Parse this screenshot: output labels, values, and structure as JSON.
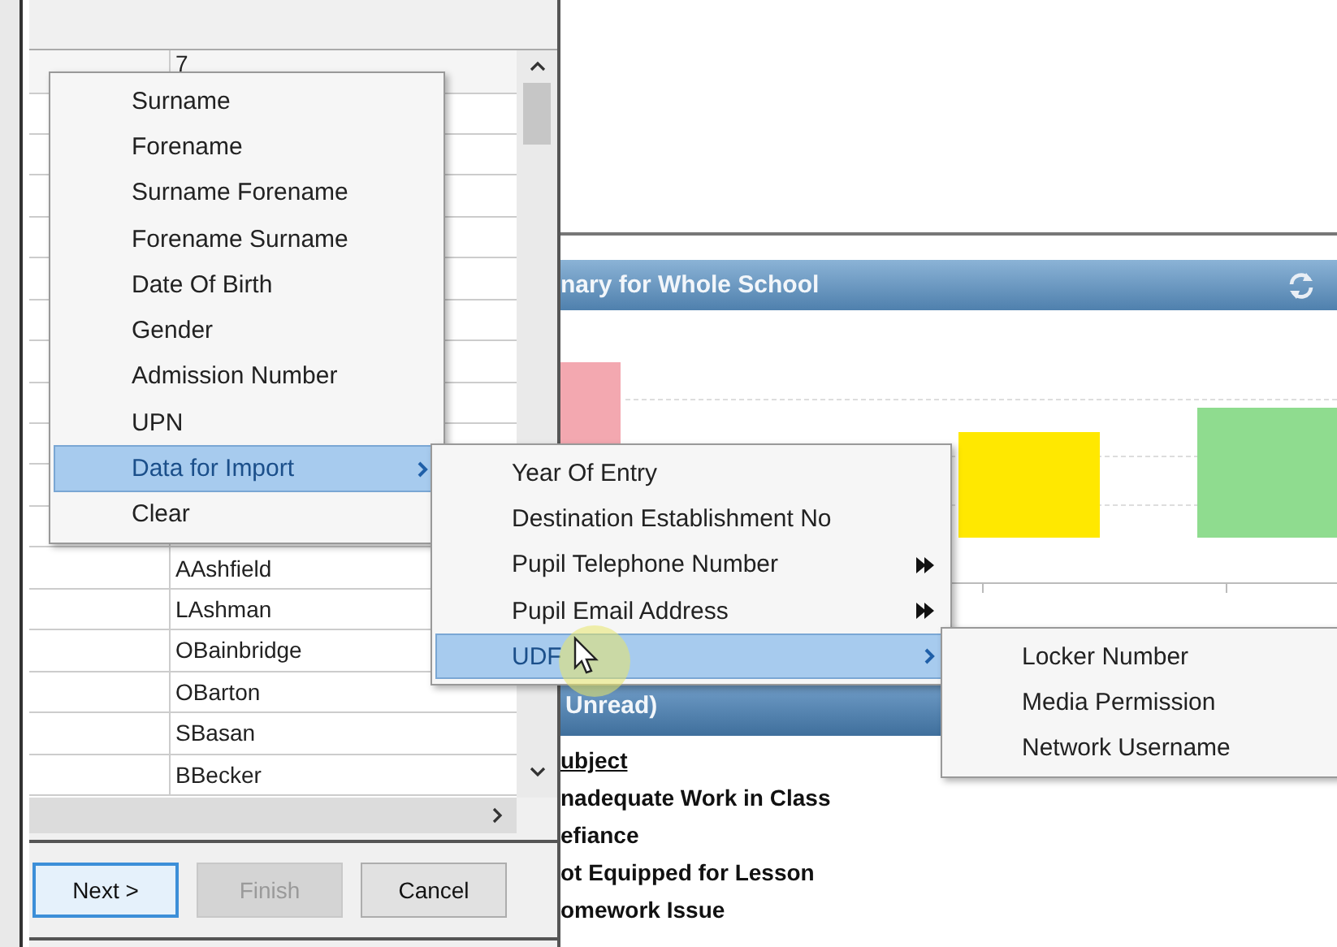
{
  "grid": {
    "header": "7",
    "rows": [
      "AAshfield",
      "LAshman",
      "OBainbridge",
      "OBarton",
      "SBasan",
      "BBecker"
    ]
  },
  "buttons": [
    {
      "label": "Next >",
      "disabled": false,
      "focused": true
    },
    {
      "label": "Finish",
      "disabled": true,
      "focused": false
    },
    {
      "label": "Cancel",
      "disabled": false,
      "focused": false
    }
  ],
  "dashboard": {
    "summary_title": "nary for Whole School",
    "messages_title": "Unread)",
    "messages": [
      {
        "text": "ubject",
        "kind": "heading"
      },
      {
        "text": "nadequate Work in Class",
        "kind": "item"
      },
      {
        "text": "efiance",
        "kind": "item"
      },
      {
        "text": "ot Equipped for Lesson",
        "kind": "item"
      },
      {
        "text": "omework Issue",
        "kind": "item"
      }
    ]
  },
  "context_menu": {
    "items": [
      {
        "label": "Surname",
        "kind": "item",
        "selected": false
      },
      {
        "label": "Forename",
        "kind": "item",
        "selected": false
      },
      {
        "label": "Surname Forename",
        "kind": "item",
        "selected": false
      },
      {
        "label": "Forename Surname",
        "kind": "item",
        "selected": false
      },
      {
        "label": "Date Of Birth",
        "kind": "item",
        "selected": false
      },
      {
        "label": "Gender",
        "kind": "item",
        "selected": false
      },
      {
        "label": "Admission Number",
        "kind": "item",
        "selected": false
      },
      {
        "label": "UPN",
        "kind": "item",
        "selected": false
      },
      {
        "label": "Data for Import",
        "kind": "submenu",
        "selected": true
      },
      {
        "label": "Clear",
        "kind": "item",
        "selected": false
      }
    ]
  },
  "import_menu": {
    "items": [
      {
        "label": "Year Of Entry",
        "kind": "item",
        "selected": false
      },
      {
        "label": "Destination Establishment No",
        "kind": "item",
        "selected": false
      },
      {
        "label": "Pupil Telephone Number",
        "kind": "expandable",
        "selected": false
      },
      {
        "label": "Pupil Email Address",
        "kind": "expandable",
        "selected": false
      },
      {
        "label": "UDF",
        "kind": "submenu",
        "selected": true
      }
    ]
  },
  "udf_menu": {
    "items": [
      {
        "label": "Locker Number",
        "selected": false
      },
      {
        "label": "Media Permission",
        "selected": false
      },
      {
        "label": "Network Username",
        "selected": false
      }
    ]
  }
}
